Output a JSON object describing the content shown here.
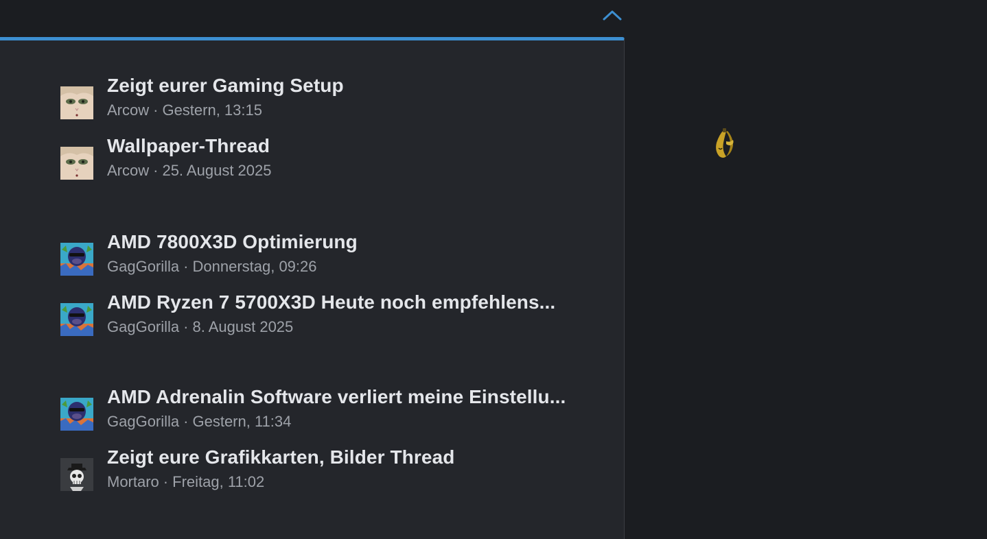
{
  "header": {
    "collapse_icon": "chevron-up-icon",
    "accent_color": "#3d8fd1"
  },
  "groups": [
    {
      "threads": [
        {
          "title": "Zeigt eurer Gaming Setup",
          "author": "Arcow",
          "separator": "·",
          "date": "Gestern, 13:15",
          "avatar": "anime-avatar"
        },
        {
          "title": "Wallpaper-Thread",
          "author": "Arcow",
          "separator": "·",
          "date": "25. August 2025",
          "avatar": "anime-avatar"
        }
      ]
    },
    {
      "threads": [
        {
          "title": "AMD 7800X3D Optimierung",
          "author": "GagGorilla",
          "separator": "·",
          "date": "Donnerstag, 09:26",
          "avatar": "gorilla-avatar"
        },
        {
          "title": "AMD Ryzen 7 5700X3D Heute noch empfehlens...",
          "author": "GagGorilla",
          "separator": "·",
          "date": "8. August 2025",
          "avatar": "gorilla-avatar"
        }
      ]
    },
    {
      "threads": [
        {
          "title": "AMD Adrenalin Software verliert meine Einstellu...",
          "author": "GagGorilla",
          "separator": "·",
          "date": "Gestern, 11:34",
          "avatar": "gorilla-avatar"
        },
        {
          "title": "Zeigt eure Grafikkarten, Bilder Thread",
          "author": "Mortaro",
          "separator": "·",
          "date": "Freitag, 11:02",
          "avatar": "skull-avatar"
        }
      ]
    }
  ],
  "sidebar": {
    "mascot_icon": "banana-icon"
  }
}
